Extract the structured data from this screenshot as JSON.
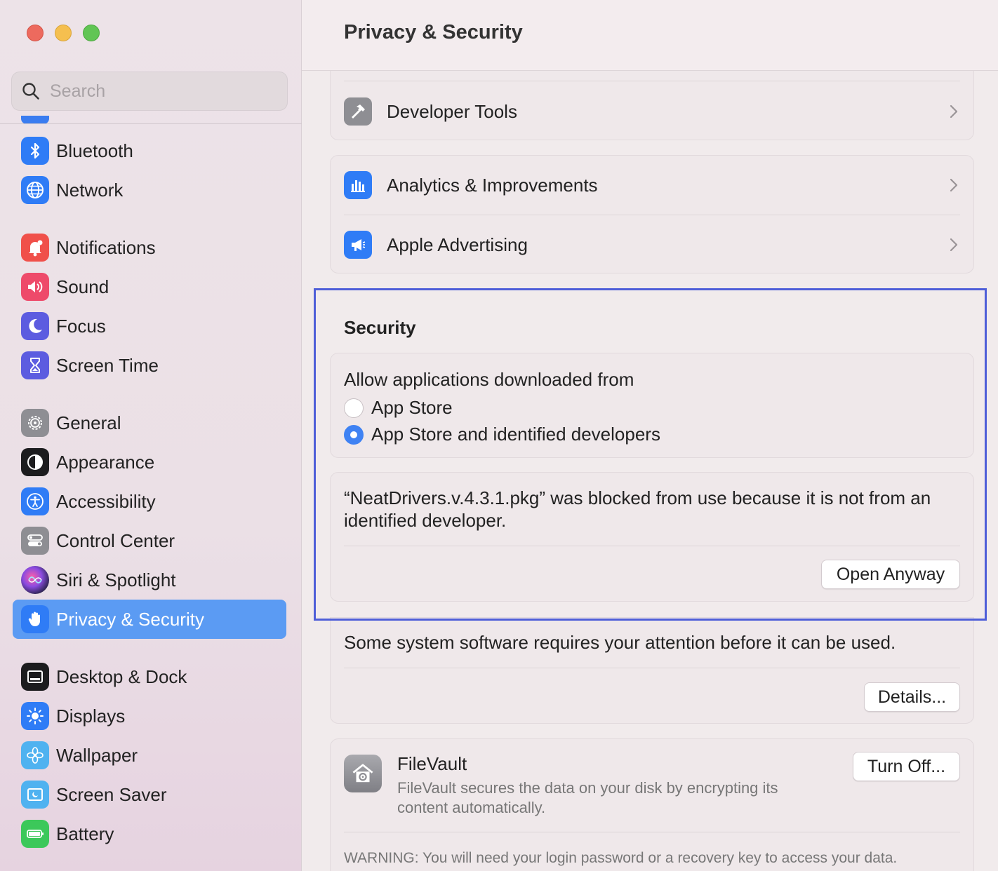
{
  "window": {
    "title": "Privacy & Security"
  },
  "sidebar": {
    "search": {
      "placeholder": "Search",
      "value": ""
    },
    "items": [
      {
        "label": "Bluetooth",
        "icon": "bluetooth-icon",
        "color": "#2f7cf6",
        "active": false
      },
      {
        "label": "Network",
        "icon": "globe-icon",
        "color": "#2f7cf6",
        "active": false
      },
      {
        "label": "Notifications",
        "icon": "bell-icon",
        "color": "#f0504a",
        "active": false
      },
      {
        "label": "Sound",
        "icon": "speaker-icon",
        "color": "#ee4a6a",
        "active": false
      },
      {
        "label": "Focus",
        "icon": "moon-icon",
        "color": "#5c5ce0",
        "active": false
      },
      {
        "label": "Screen Time",
        "icon": "hourglass-icon",
        "color": "#5c5ce0",
        "active": false
      },
      {
        "label": "General",
        "icon": "gear-icon",
        "color": "#8e8e93",
        "active": false
      },
      {
        "label": "Appearance",
        "icon": "appearance-icon",
        "color": "#1c1c1e",
        "active": false
      },
      {
        "label": "Accessibility",
        "icon": "accessibility-icon",
        "color": "#2f7cf6",
        "active": false
      },
      {
        "label": "Control Center",
        "icon": "toggles-icon",
        "color": "#8e8e93",
        "active": false
      },
      {
        "label": "Siri & Spotlight",
        "icon": "siri-icon",
        "color": "#3a2a6a",
        "active": false
      },
      {
        "label": "Privacy & Security",
        "icon": "hand-icon",
        "color": "#2f7cf6",
        "active": true
      },
      {
        "label": "Desktop & Dock",
        "icon": "dock-icon",
        "color": "#1c1c1e",
        "active": false
      },
      {
        "label": "Displays",
        "icon": "sun-icon",
        "color": "#2f7cf6",
        "active": false
      },
      {
        "label": "Wallpaper",
        "icon": "flower-icon",
        "color": "#4fb2f0",
        "active": false
      },
      {
        "label": "Screen Saver",
        "icon": "screensaver-icon",
        "color": "#4fb2f0",
        "active": false
      },
      {
        "label": "Battery",
        "icon": "battery-icon",
        "color": "#3cc85a",
        "active": false
      }
    ]
  },
  "main": {
    "privacy_rows": [
      {
        "label": "Developer Tools",
        "icon": "hammer-icon"
      },
      {
        "label": "Analytics & Improvements",
        "icon": "bar-chart-icon"
      },
      {
        "label": "Apple Advertising",
        "icon": "megaphone-icon"
      }
    ],
    "security": {
      "title": "Security",
      "allow_label": "Allow applications downloaded from",
      "options": [
        {
          "label": "App Store",
          "selected": false
        },
        {
          "label": "App Store and identified developers",
          "selected": true
        }
      ],
      "blocked_message": "“NeatDrivers.v.4.3.1.pkg” was blocked from use because it is not from an identified developer.",
      "open_anyway_label": "Open Anyway"
    },
    "system_software": {
      "message": "Some system software requires your attention before it can be used.",
      "details_label": "Details..."
    },
    "filevault": {
      "title": "FileVault",
      "description": "FileVault secures the data on your disk by encrypting its content automatically.",
      "turn_off_label": "Turn Off...",
      "warning": "WARNING: You will need your login password or a recovery key to access your data."
    }
  },
  "colors": {
    "accent": "#5b9bf3",
    "highlight_border": "#4e5ed8",
    "radio_selected": "#3f82f3"
  }
}
